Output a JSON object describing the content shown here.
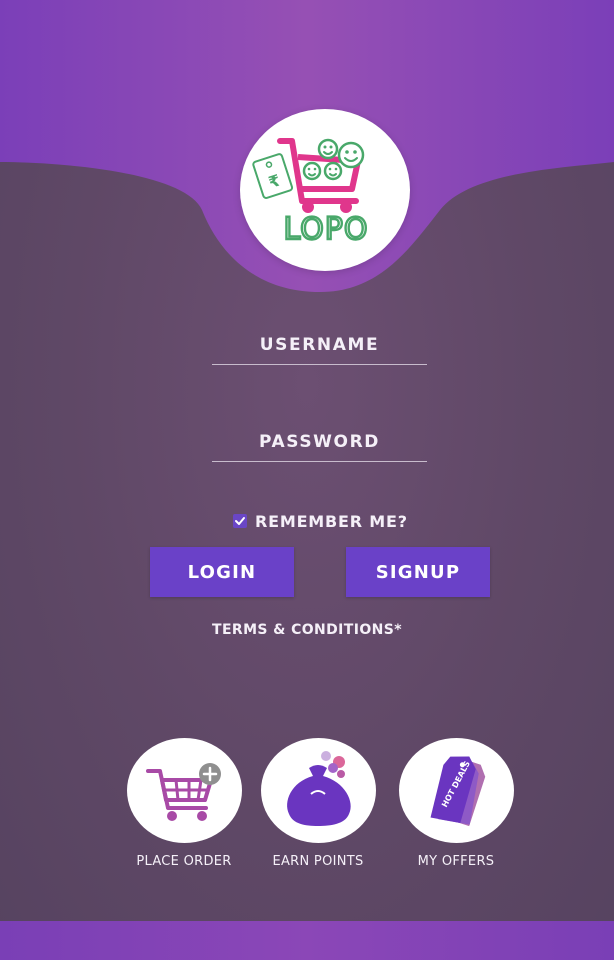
{
  "app": {
    "logo_text": "LOPO",
    "tag_symbol": "₹"
  },
  "login_form": {
    "username_label": "USERNAME",
    "password_label": "PASSWORD",
    "remember_me_label": "REMEMBER ME?",
    "remember_me_checked": true,
    "login_button": "LOGIN",
    "signup_button": "SIGNUP",
    "terms_link": "TERMS & CONDITIONS*"
  },
  "features": [
    {
      "label": "PLACE ORDER",
      "icon": "cart-plus-icon"
    },
    {
      "label": "EARN POINTS",
      "icon": "money-bag-icon"
    },
    {
      "label": "MY OFFERS",
      "icon": "hot-deals-tag-icon",
      "tag_text": "HOT DEALS"
    }
  ],
  "colors": {
    "primary": "#6a41c8",
    "header_purple": "#8e45b5",
    "background": "#5f4866",
    "logo_pink": "#e0368c",
    "logo_green": "#49a86a"
  }
}
